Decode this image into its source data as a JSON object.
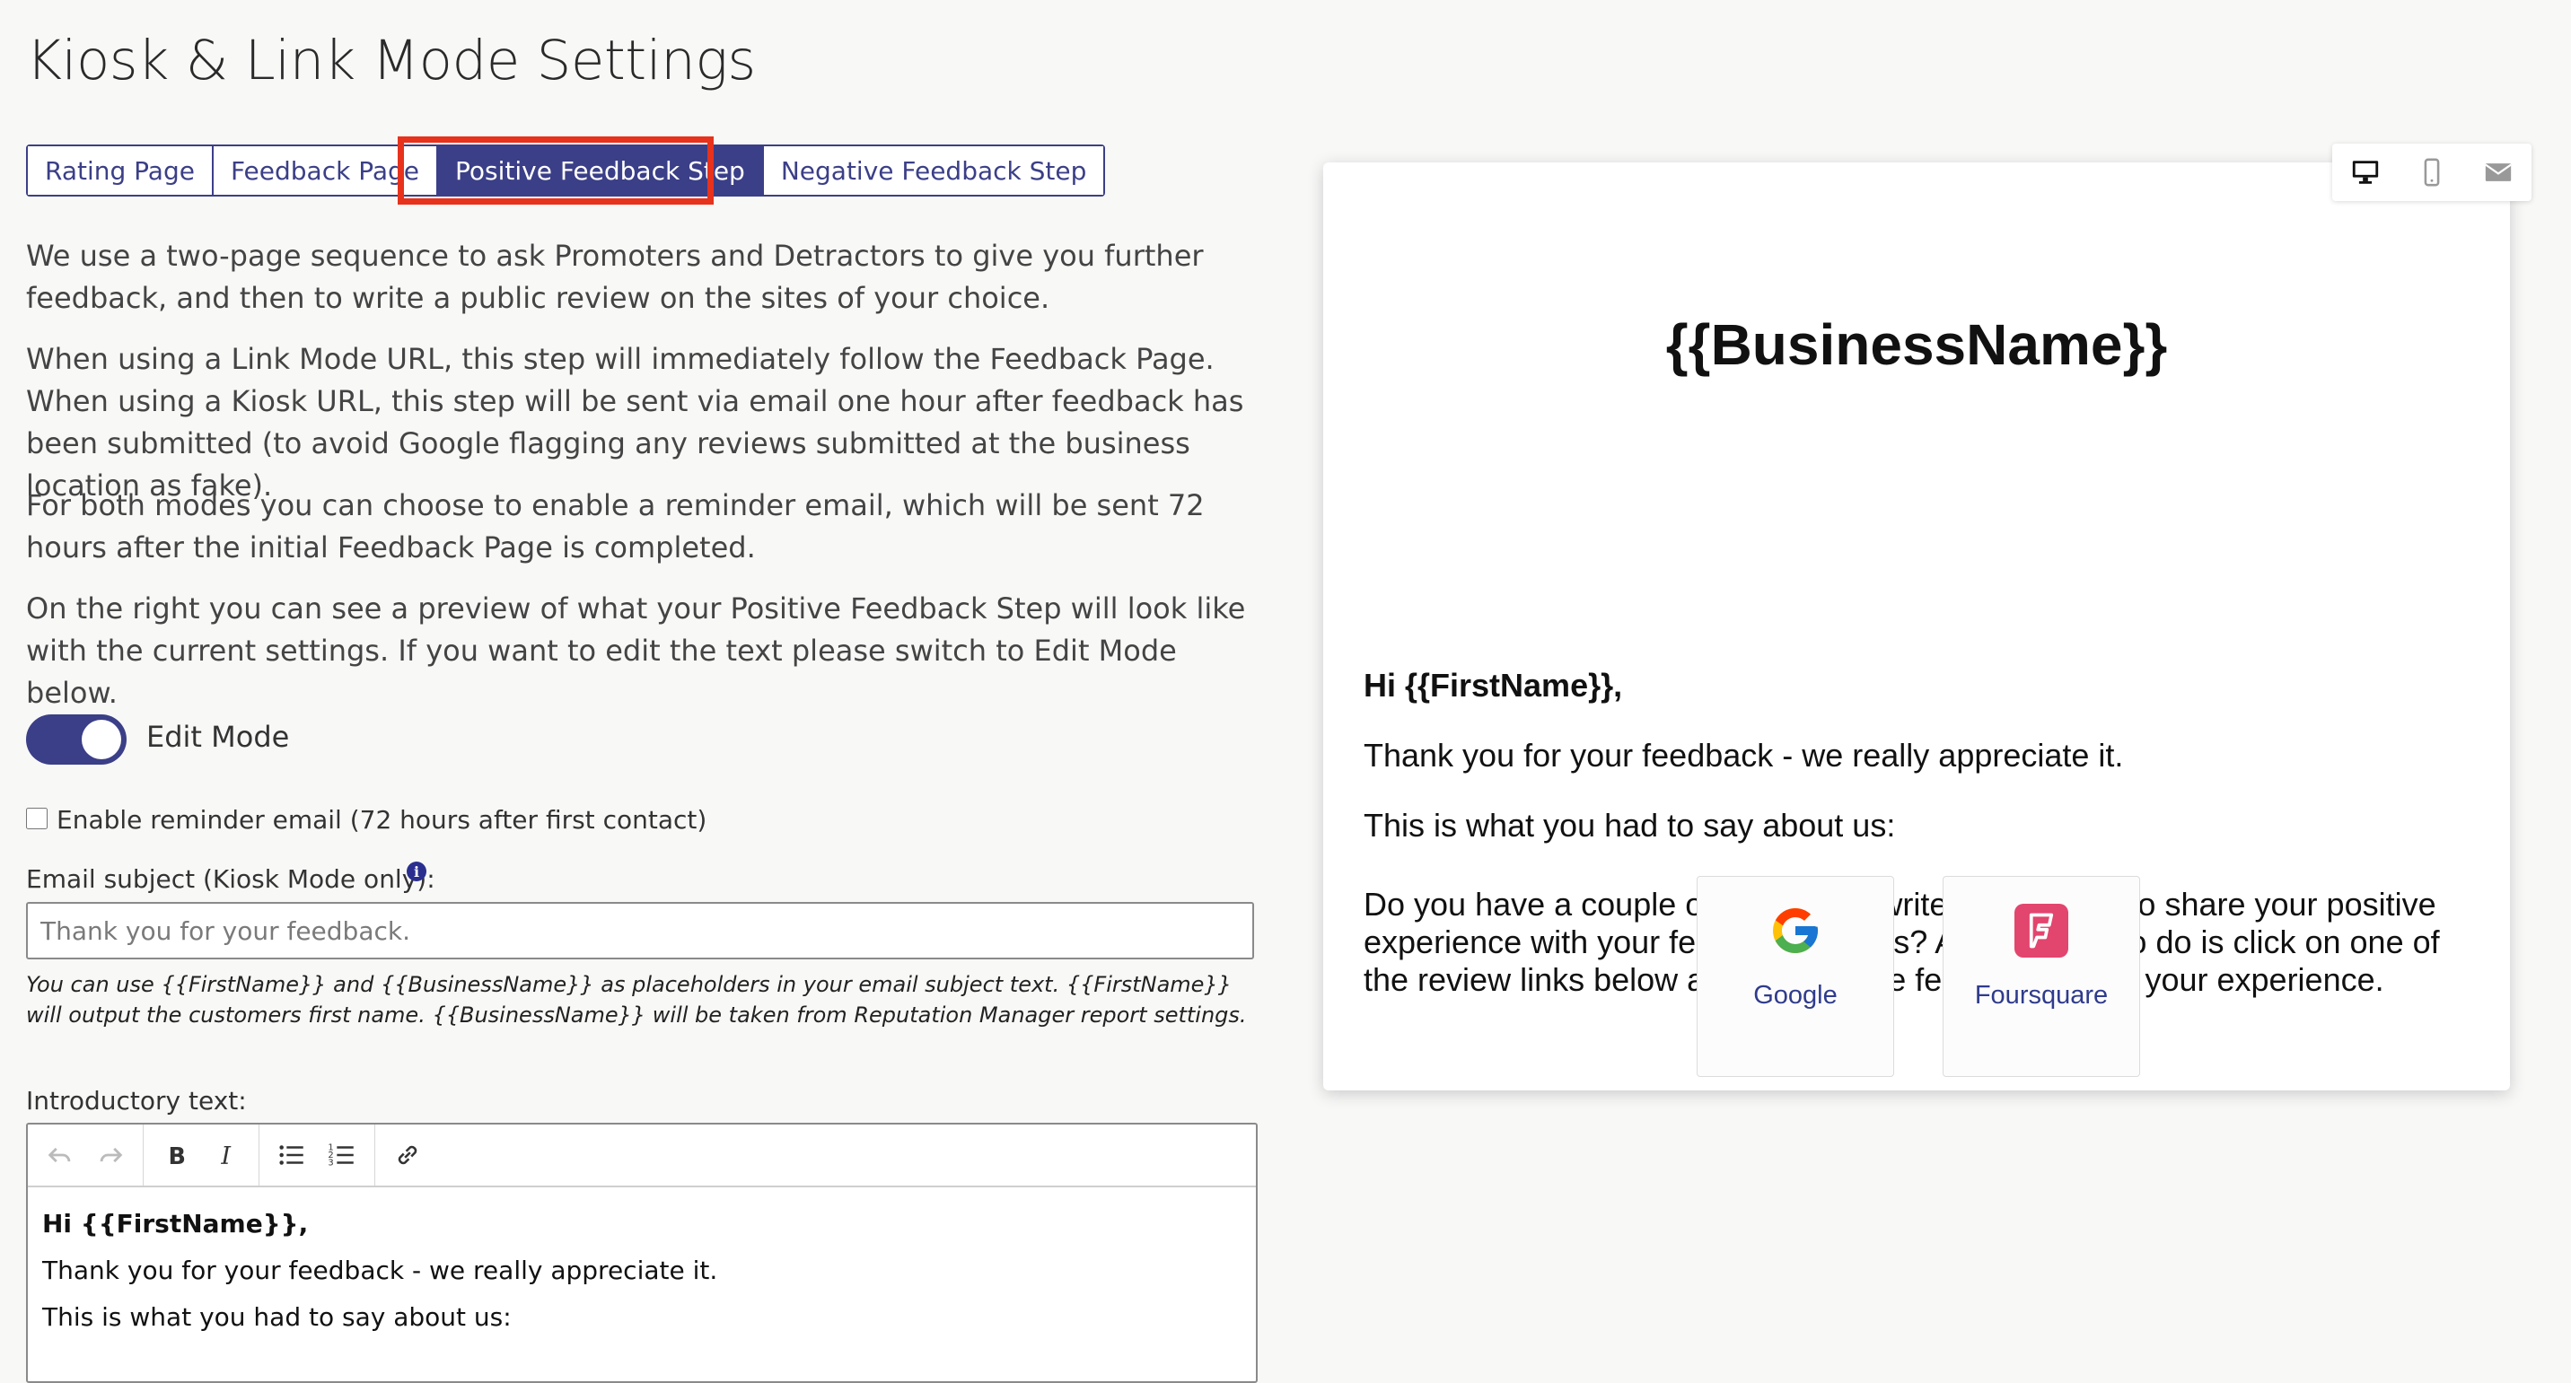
{
  "page": {
    "title": "Kiosk & Link Mode Settings"
  },
  "tabs": [
    {
      "label": "Rating Page",
      "active": false
    },
    {
      "label": "Feedback Page",
      "active": false
    },
    {
      "label": "Positive Feedback Step",
      "active": true
    },
    {
      "label": "Negative Feedback Step",
      "active": false
    }
  ],
  "description": [
    "We use a two-page sequence to ask Promoters and Detractors to give you further feedback, and then to write a public review on the sites of your choice.",
    "When using a Link Mode URL, this step will immediately follow the Feedback Page. When using a Kiosk URL, this step will be sent via email one hour after feedback has been submitted (to avoid Google flagging any reviews submitted at the business location as fake).",
    "For both modes you can choose to enable a reminder email, which will be sent 72 hours after the initial Feedback Page is completed.",
    "On the right you can see a preview of what your Positive Feedback Step will look like with the current settings. If you want to edit the text please switch to Edit Mode below."
  ],
  "edit_mode": {
    "label": "Edit Mode",
    "on": true
  },
  "reminder": {
    "label": "Enable reminder email (72 hours after first contact)",
    "checked": false
  },
  "subject": {
    "label": "Email subject (Kiosk Mode only):",
    "info_icon": "info-icon",
    "placeholder": "Thank you for your feedback.",
    "help": "You can use {{FirstName}} and {{BusinessName}} as placeholders in your email subject text. {{FirstName}} will output the customers first name. {{BusinessName}} will be taken from Reputation Manager report settings."
  },
  "intro": {
    "label": "Introductory text:",
    "toolbar": [
      "undo-icon",
      "redo-icon",
      "bold-icon",
      "italic-icon",
      "bullet-list-icon",
      "numbered-list-icon",
      "link-icon"
    ],
    "lines": [
      "Hi {{FirstName}},",
      "Thank you for your feedback - we really appreciate it.",
      "This is what you had to say about us:"
    ]
  },
  "preview": {
    "devices": [
      "desktop-icon",
      "mobile-icon",
      "email-icon"
    ],
    "business_name": "{{BusinessName}}",
    "greeting": "Hi {{FirstName}},",
    "thanks": "Thank you for your feedback - we really appreciate it.",
    "said": "This is what you had to say about us:",
    "ask": "Do you have a couple of minutes to write us a review to share your positive experience with your fellow customers? All you have to do is click on one of the review links below and write some feedback about your experience.",
    "review_sites": [
      {
        "label": "Google",
        "icon": "google-icon"
      },
      {
        "label": "Foursquare",
        "icon": "foursquare-icon"
      }
    ]
  },
  "colors": {
    "accent": "#3b3f87",
    "highlight": "#e7321c",
    "link": "#2f3b8c",
    "foursquare": "#e2456e"
  }
}
